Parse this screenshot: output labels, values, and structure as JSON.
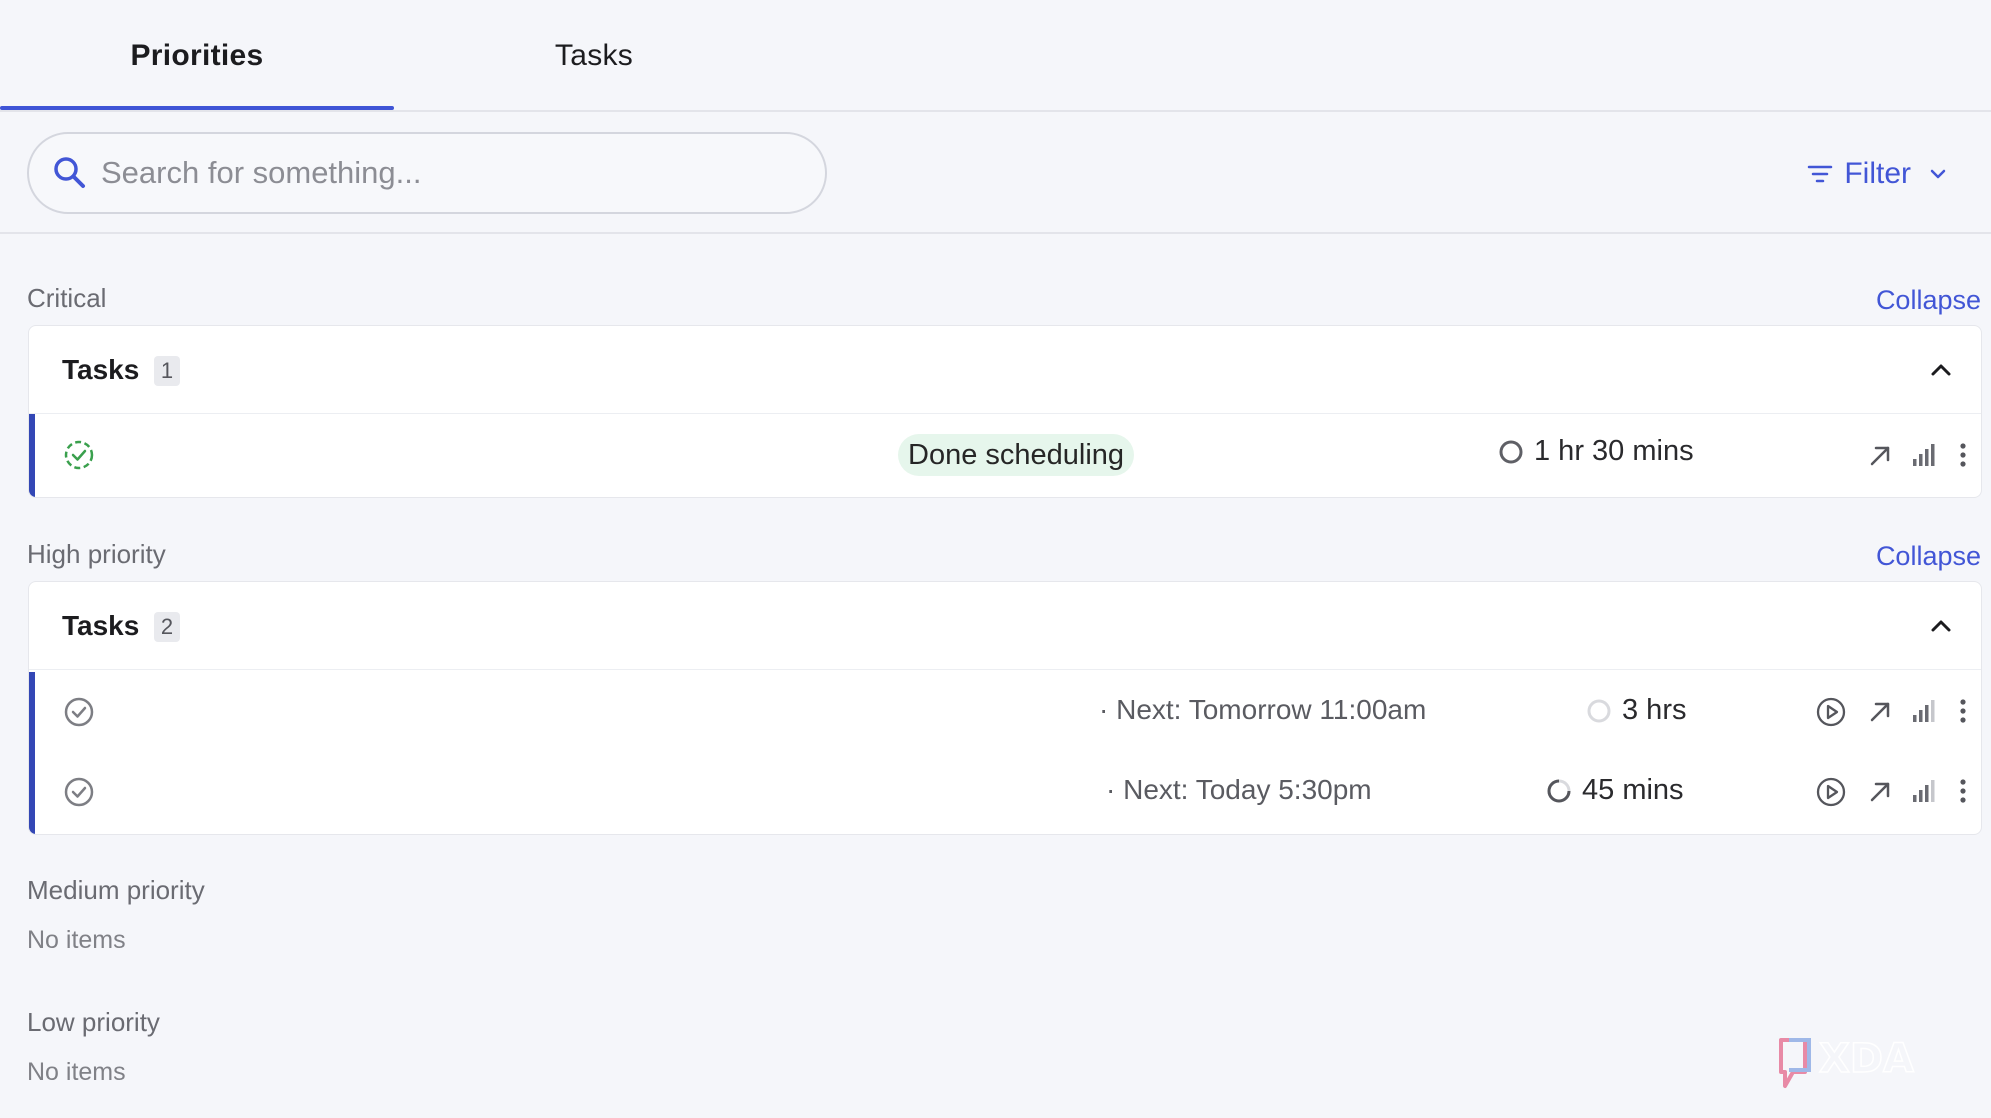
{
  "tabs": [
    {
      "label": "Priorities",
      "active": true
    },
    {
      "label": "Tasks",
      "active": false
    }
  ],
  "search": {
    "placeholder": "Search for something..."
  },
  "filter": {
    "label": "Filter"
  },
  "accent_color": "#4256d6",
  "critical": {
    "label": "Critical",
    "collapse_label": "Collapse",
    "group_title": "Tasks",
    "count": "1",
    "tasks": [
      {
        "status_pill": "Done scheduling",
        "duration": "1 hr 30 mins",
        "icon": "check-dashed-green"
      }
    ]
  },
  "high": {
    "label": "High priority",
    "collapse_label": "Collapse",
    "group_title": "Tasks",
    "count": "2",
    "tasks": [
      {
        "next": "· Next: Tomorrow 11:00am",
        "duration": "3 hrs"
      },
      {
        "next": "· Next: Today 5:30pm",
        "duration": "45 mins"
      }
    ]
  },
  "medium": {
    "label": "Medium priority",
    "empty": "No items"
  },
  "low": {
    "label": "Low priority",
    "empty": "No items"
  },
  "watermark": {
    "text": "XDA"
  }
}
